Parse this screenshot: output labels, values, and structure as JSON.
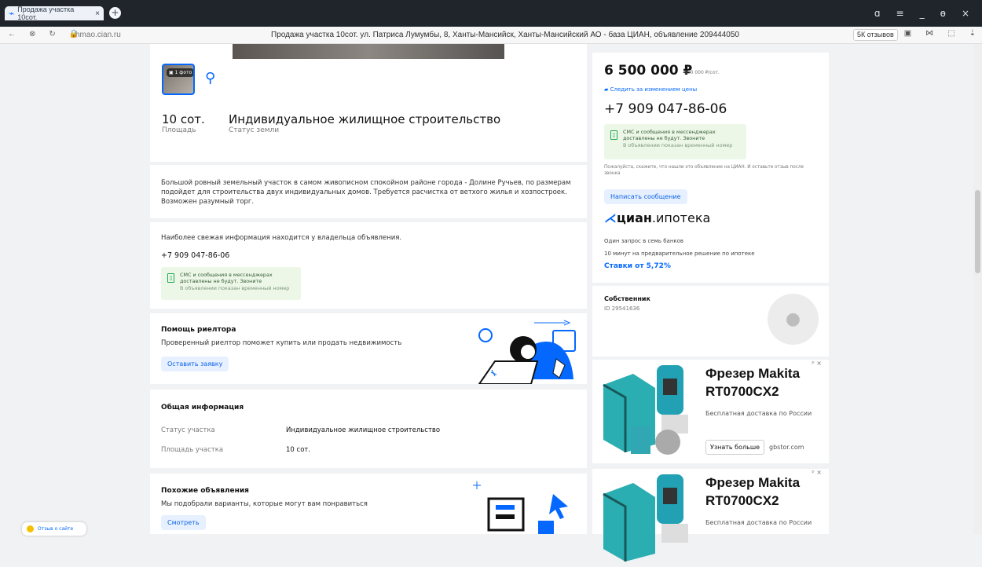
{
  "browser": {
    "tab_title": "Продажа участка 10сот.",
    "tab_close": "×",
    "new_tab": "+",
    "window_controls": [
      "ɑ",
      "≡",
      "_",
      "ɵ",
      "×"
    ],
    "nav": [
      "←",
      "⊗",
      "↻",
      "🔒"
    ],
    "url": "hmao.cian.ru",
    "page_title": "Продажа участка 10сот. ул. Патриса Лумумбы, 8, Ханты-Мансийск, Ханты-Мансийский АО - база ЦИАН, объявление 209444050",
    "reviews": "5К отзывов",
    "tools": [
      "▣",
      "⋈",
      "⬚",
      "⇣"
    ]
  },
  "photo": {
    "count_label": "1 фото"
  },
  "facts": {
    "area_value": "10 сот.",
    "area_label": "Площадь",
    "status_value": "Индивидуальное жилищное строительство",
    "status_label": "Статус земли"
  },
  "description": "Большой ровный земельный участок в самом живописном спокойном районе города - Долине Ручьев, по размерам подойдет для строительства двух индивидуальных домов. Требуется расчистка от ветхого жилья и хозпостроек. Возможен разумный торг.",
  "contact": {
    "info": "Наиболее свежая информация находится у владельца объявления.",
    "phone": "+7 909 047-86-06",
    "sms_line1": "СМС и сообщения в мессенджерах",
    "sms_line2": "доставлены не будут. Звоните",
    "sms_line3": "В объявлении показан временный номер"
  },
  "realtor": {
    "title": "Помощь риелтора",
    "text": "Проверенный риелтор поможет купить или продать недвижимость",
    "button": "Оставить заявку"
  },
  "general": {
    "title": "Общая информация",
    "row1_label": "Статус участка",
    "row1_value": "Индивидуальное жилищное строительство",
    "row2_label": "Площадь участка",
    "row2_value": "10 сот."
  },
  "similar": {
    "title": "Похожие объявления",
    "text": "Мы подобрали варианты, которые могут вам понравиться",
    "button": "Смотреть"
  },
  "feedback": {
    "label": "Отзыв о сайте"
  },
  "sidebar": {
    "price": "6 500 000 ₽",
    "price_per": "650 000 ₽/сот.",
    "follow": "Следить за изменением цены",
    "phone": "+7 909 047-86-06",
    "sms_line1": "СМС и сообщения в мессенджерах",
    "sms_line2": "доставлены не будут. Звоните",
    "sms_line3": "В объявлении показан временный номер",
    "notice_text": "Пожалуйста, скажите, что нашли это объявление на ЦИАН. И оставьте отзыв после звонка",
    "write_button": "Написать сообщение",
    "brand_cian": "циан",
    "brand_rest": ".ипотека",
    "ipoteka_line1": "Один запрос в семь банков",
    "ipoteka_line2": "10 минут на предварительное решение по ипотеке",
    "rate": "Ставки от 5,72%",
    "owner_label": "Собственник",
    "owner_id": "ID 29541636"
  },
  "ads": [
    {
      "title_line1": "Фрезер Makita",
      "title_line2": "RT0700CX2",
      "desc": "Бесплатная доставка по России",
      "button": "Узнать больше",
      "domain": "gbstor.com",
      "mark": "ᵖ ×"
    },
    {
      "title_line1": "Фрезер Makita",
      "title_line2": "RT0700CX2",
      "desc": "Бесплатная доставка по России",
      "mark": "ᵖ ×"
    }
  ],
  "colors": {
    "accent": "#0468ff",
    "green": "#18a84f",
    "topbar": "#20242b",
    "page": "#f1f2f4"
  },
  "icons": {
    "feedback": "smile-icon",
    "follow": "notification-icon",
    "phone_note": "phone-icon",
    "avatar": "user-icon",
    "photo": "camera-icon"
  }
}
